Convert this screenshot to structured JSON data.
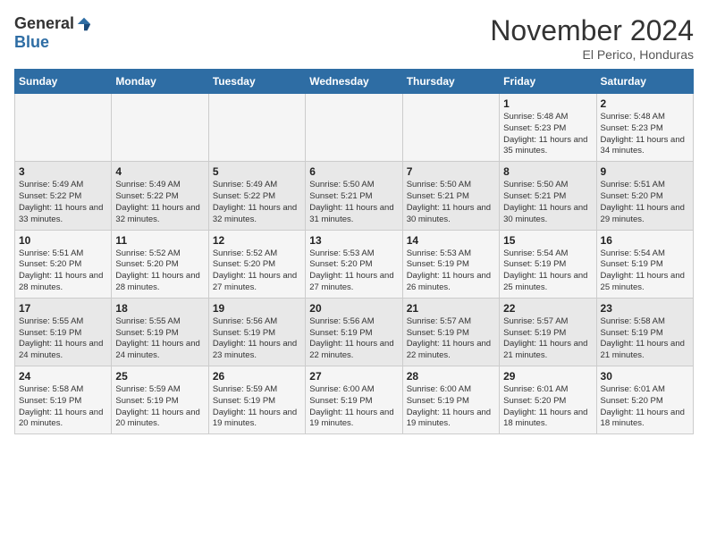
{
  "header": {
    "logo_general": "General",
    "logo_blue": "Blue",
    "month_title": "November 2024",
    "location": "El Perico, Honduras"
  },
  "calendar": {
    "days_of_week": [
      "Sunday",
      "Monday",
      "Tuesday",
      "Wednesday",
      "Thursday",
      "Friday",
      "Saturday"
    ],
    "weeks": [
      [
        {
          "day": "",
          "info": ""
        },
        {
          "day": "",
          "info": ""
        },
        {
          "day": "",
          "info": ""
        },
        {
          "day": "",
          "info": ""
        },
        {
          "day": "",
          "info": ""
        },
        {
          "day": "1",
          "info": "Sunrise: 5:48 AM\nSunset: 5:23 PM\nDaylight: 11 hours and 35 minutes."
        },
        {
          "day": "2",
          "info": "Sunrise: 5:48 AM\nSunset: 5:23 PM\nDaylight: 11 hours and 34 minutes."
        }
      ],
      [
        {
          "day": "3",
          "info": "Sunrise: 5:49 AM\nSunset: 5:22 PM\nDaylight: 11 hours and 33 minutes."
        },
        {
          "day": "4",
          "info": "Sunrise: 5:49 AM\nSunset: 5:22 PM\nDaylight: 11 hours and 32 minutes."
        },
        {
          "day": "5",
          "info": "Sunrise: 5:49 AM\nSunset: 5:22 PM\nDaylight: 11 hours and 32 minutes."
        },
        {
          "day": "6",
          "info": "Sunrise: 5:50 AM\nSunset: 5:21 PM\nDaylight: 11 hours and 31 minutes."
        },
        {
          "day": "7",
          "info": "Sunrise: 5:50 AM\nSunset: 5:21 PM\nDaylight: 11 hours and 30 minutes."
        },
        {
          "day": "8",
          "info": "Sunrise: 5:50 AM\nSunset: 5:21 PM\nDaylight: 11 hours and 30 minutes."
        },
        {
          "day": "9",
          "info": "Sunrise: 5:51 AM\nSunset: 5:20 PM\nDaylight: 11 hours and 29 minutes."
        }
      ],
      [
        {
          "day": "10",
          "info": "Sunrise: 5:51 AM\nSunset: 5:20 PM\nDaylight: 11 hours and 28 minutes."
        },
        {
          "day": "11",
          "info": "Sunrise: 5:52 AM\nSunset: 5:20 PM\nDaylight: 11 hours and 28 minutes."
        },
        {
          "day": "12",
          "info": "Sunrise: 5:52 AM\nSunset: 5:20 PM\nDaylight: 11 hours and 27 minutes."
        },
        {
          "day": "13",
          "info": "Sunrise: 5:53 AM\nSunset: 5:20 PM\nDaylight: 11 hours and 27 minutes."
        },
        {
          "day": "14",
          "info": "Sunrise: 5:53 AM\nSunset: 5:19 PM\nDaylight: 11 hours and 26 minutes."
        },
        {
          "day": "15",
          "info": "Sunrise: 5:54 AM\nSunset: 5:19 PM\nDaylight: 11 hours and 25 minutes."
        },
        {
          "day": "16",
          "info": "Sunrise: 5:54 AM\nSunset: 5:19 PM\nDaylight: 11 hours and 25 minutes."
        }
      ],
      [
        {
          "day": "17",
          "info": "Sunrise: 5:55 AM\nSunset: 5:19 PM\nDaylight: 11 hours and 24 minutes."
        },
        {
          "day": "18",
          "info": "Sunrise: 5:55 AM\nSunset: 5:19 PM\nDaylight: 11 hours and 24 minutes."
        },
        {
          "day": "19",
          "info": "Sunrise: 5:56 AM\nSunset: 5:19 PM\nDaylight: 11 hours and 23 minutes."
        },
        {
          "day": "20",
          "info": "Sunrise: 5:56 AM\nSunset: 5:19 PM\nDaylight: 11 hours and 22 minutes."
        },
        {
          "day": "21",
          "info": "Sunrise: 5:57 AM\nSunset: 5:19 PM\nDaylight: 11 hours and 22 minutes."
        },
        {
          "day": "22",
          "info": "Sunrise: 5:57 AM\nSunset: 5:19 PM\nDaylight: 11 hours and 21 minutes."
        },
        {
          "day": "23",
          "info": "Sunrise: 5:58 AM\nSunset: 5:19 PM\nDaylight: 11 hours and 21 minutes."
        }
      ],
      [
        {
          "day": "24",
          "info": "Sunrise: 5:58 AM\nSunset: 5:19 PM\nDaylight: 11 hours and 20 minutes."
        },
        {
          "day": "25",
          "info": "Sunrise: 5:59 AM\nSunset: 5:19 PM\nDaylight: 11 hours and 20 minutes."
        },
        {
          "day": "26",
          "info": "Sunrise: 5:59 AM\nSunset: 5:19 PM\nDaylight: 11 hours and 19 minutes."
        },
        {
          "day": "27",
          "info": "Sunrise: 6:00 AM\nSunset: 5:19 PM\nDaylight: 11 hours and 19 minutes."
        },
        {
          "day": "28",
          "info": "Sunrise: 6:00 AM\nSunset: 5:19 PM\nDaylight: 11 hours and 19 minutes."
        },
        {
          "day": "29",
          "info": "Sunrise: 6:01 AM\nSunset: 5:20 PM\nDaylight: 11 hours and 18 minutes."
        },
        {
          "day": "30",
          "info": "Sunrise: 6:01 AM\nSunset: 5:20 PM\nDaylight: 11 hours and 18 minutes."
        }
      ]
    ]
  }
}
